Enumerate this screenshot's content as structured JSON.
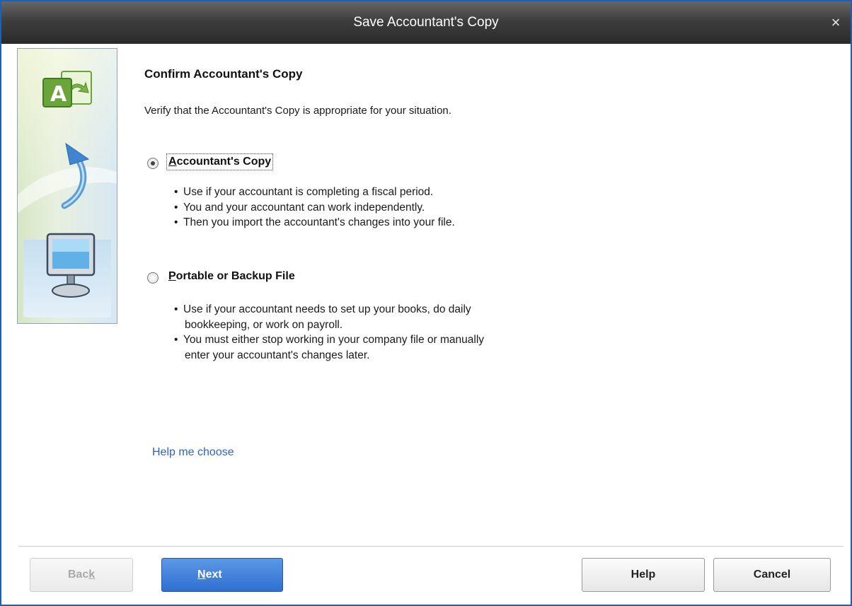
{
  "window": {
    "title": "Save Accountant's Copy",
    "close_glyph": "×"
  },
  "sidebar": {
    "icons": [
      "accountant-copy-icon",
      "curved-arrow-icon",
      "computer-monitor-icon"
    ],
    "accent_green": "#6aa43a",
    "accent_blue": "#4b8fd1"
  },
  "main": {
    "heading": "Confirm Accountant's Copy",
    "subtext": "Verify that the Accountant's Copy is appropriate for your situation.",
    "options": [
      {
        "label_first": "A",
        "label_rest": "ccountant's Copy",
        "selected": true,
        "bullets": [
          "Use if your accountant is completing a fiscal period.",
          "You and your accountant can work independently.",
          "Then you import the accountant's changes into your file."
        ]
      },
      {
        "label_first": "P",
        "label_rest": "ortable or Backup File",
        "selected": false,
        "bullets": [
          [
            "Use if your accountant needs to set up your books, do daily",
            "bookkeeping, or work on payroll."
          ],
          [
            "You must either stop working in your company file or manually",
            "enter your accountant's changes later."
          ]
        ]
      }
    ],
    "help_link": "Help me choose"
  },
  "footer": {
    "back": {
      "pre": "Bac",
      "ul": "k",
      "post": ""
    },
    "next": {
      "pre": "",
      "ul": "N",
      "post": "ext"
    },
    "help": "Help",
    "cancel": "Cancel",
    "primary_color": "#2f6fd0"
  }
}
